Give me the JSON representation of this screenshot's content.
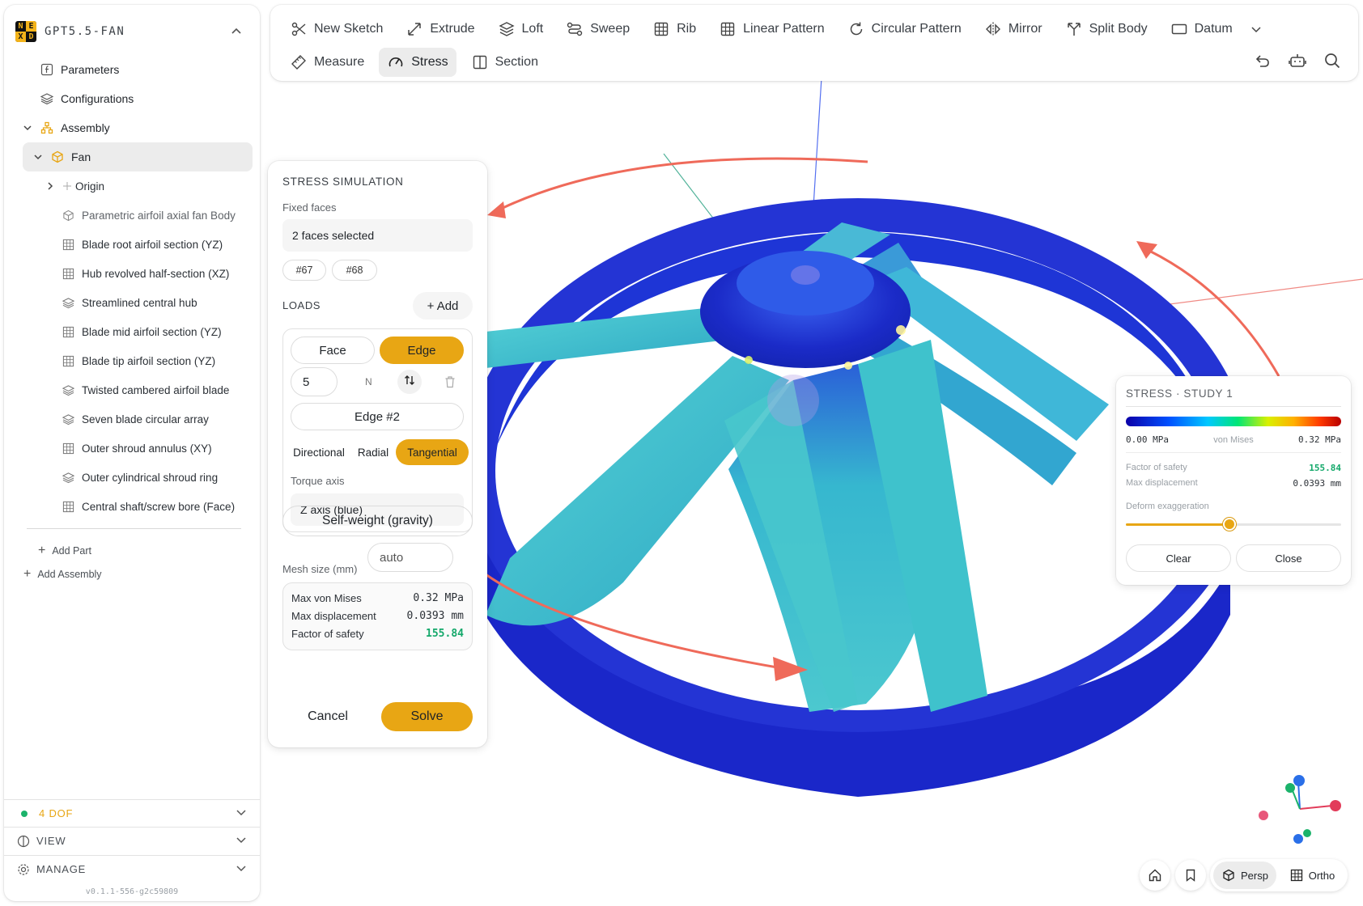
{
  "app": {
    "name": "GPT5.5-FAN",
    "logo_letters": [
      "N",
      "E",
      "X",
      "D"
    ],
    "version": "v0.1.1-556-g2c59809"
  },
  "sidebar": {
    "top_items": [
      {
        "label": "Parameters",
        "icon": "function-icon"
      },
      {
        "label": "Configurations",
        "icon": "layers-icon"
      }
    ],
    "assembly": {
      "label": "Assembly",
      "icon": "assembly-icon"
    },
    "part": {
      "label": "Fan",
      "icon": "cube-icon"
    },
    "features": [
      {
        "label": "Origin",
        "icon": "origin-icon",
        "muted": true
      },
      {
        "label": "Parametric airfoil axial fan Body",
        "icon": "body-icon"
      },
      {
        "label": "Blade root airfoil section (YZ)",
        "icon": "sketch-icon"
      },
      {
        "label": "Hub revolved half-section (XZ)",
        "icon": "sketch-icon"
      },
      {
        "label": "Streamlined central hub",
        "icon": "feature-icon"
      },
      {
        "label": "Blade mid airfoil section (YZ)",
        "icon": "sketch-icon"
      },
      {
        "label": "Blade tip airfoil section (YZ)",
        "icon": "sketch-icon"
      },
      {
        "label": "Twisted cambered airfoil blade",
        "icon": "feature-icon"
      },
      {
        "label": "Seven blade circular array",
        "icon": "feature-icon"
      },
      {
        "label": "Outer shroud annulus (XY)",
        "icon": "sketch-icon"
      },
      {
        "label": "Outer cylindrical shroud ring",
        "icon": "feature-icon"
      },
      {
        "label": "Central shaft/screw bore (Face)",
        "icon": "sketch-icon"
      }
    ],
    "add_part": "Add Part",
    "add_assembly": "Add Assembly",
    "footer": {
      "dof": "4 DOF",
      "view": "VIEW",
      "manage": "MANAGE"
    }
  },
  "toolbar": {
    "row1": [
      "New Sketch",
      "Extrude",
      "Loft",
      "Sweep",
      "Rib",
      "Linear Pattern",
      "Circular Pattern",
      "Mirror",
      "Split Body",
      "Datum"
    ],
    "row2": [
      "Measure",
      "Stress",
      "Section"
    ],
    "active": "Stress",
    "right_icons": [
      "undo-icon",
      "robot-icon",
      "search-icon"
    ]
  },
  "stress_panel": {
    "title": "STRESS SIMULATION",
    "fixed_faces_label": "Fixed faces",
    "fixed_faces_value": "2 faces selected",
    "chips": [
      "#67",
      "#68"
    ],
    "loads_label": "LOADS",
    "add_label": "+ Add",
    "load": {
      "type_options": [
        "Face",
        "Edge"
      ],
      "type_selected": "Edge",
      "magnitude": "5",
      "unit": "N",
      "target": "Edge #2",
      "direction_options": [
        "Directional",
        "Radial",
        "Tangential"
      ],
      "direction_selected": "Tangential",
      "torque_axis_label": "Torque axis",
      "torque_axis_value": "Z axis (blue)"
    },
    "self_weight": "Self-weight (gravity)",
    "mesh_label": "Mesh size (mm)",
    "mesh_placeholder": "auto",
    "results": [
      {
        "label": "Max von Mises",
        "value": "0.32 MPa"
      },
      {
        "label": "Max displacement",
        "value": "0.0393 mm"
      },
      {
        "label": "Factor of safety",
        "value": "155.84"
      }
    ],
    "cancel": "Cancel",
    "solve": "Solve"
  },
  "study_card": {
    "title": "STRESS · STUDY 1",
    "min": "0.00 MPa",
    "mid": "von Mises",
    "max": "0.32 MPa",
    "factor_label": "Factor of safety",
    "factor_value": "155.84",
    "disp_label": "Max displacement",
    "disp_value": "0.0393 mm",
    "deform_label": "Deform exaggeration",
    "deform_fraction": 0.48,
    "clear": "Clear",
    "close": "Close"
  },
  "view_controls": {
    "persp": "Persp",
    "ortho": "Ortho",
    "active": "Persp"
  },
  "colors": {
    "accent": "#e8a614",
    "safe_green": "#13a86a",
    "ring_blue": "#1f2fd0",
    "blade_teal": "#3fc3c9",
    "arrow_red": "#ef6a5a"
  }
}
